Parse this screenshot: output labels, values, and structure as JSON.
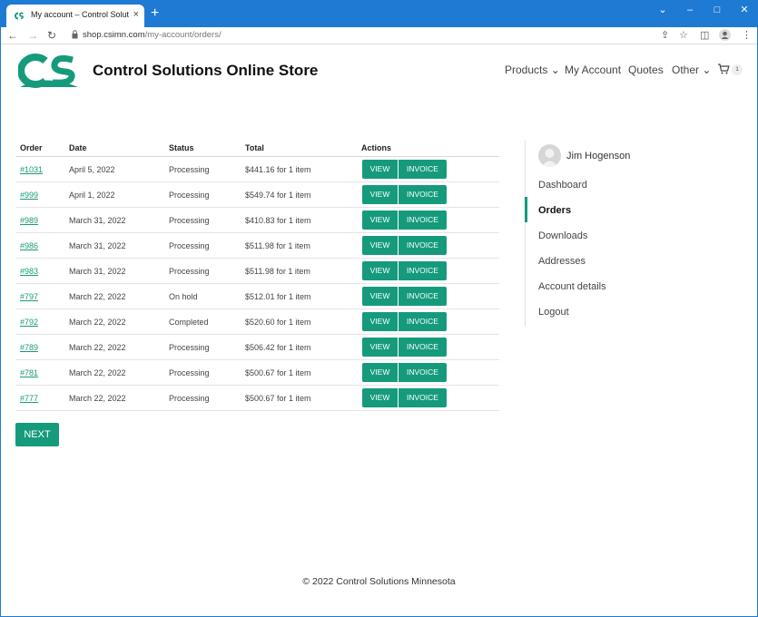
{
  "browser": {
    "tab_title": "My account – Control Solutions Online Store",
    "tab_close": "×",
    "new_tab": "+",
    "url_host": "shop.csimn.com",
    "url_path": "/my-account/orders/",
    "controls": {
      "min": "⌄",
      "minimize": "–",
      "maximize": "□",
      "close": "✕"
    },
    "nav": {
      "back": "←",
      "forward": "→",
      "reload": "↻"
    },
    "toolbar_icons": {
      "share": "⇪",
      "star": "☆",
      "sidebar": "◫",
      "menu": "⋮"
    }
  },
  "site": {
    "title": "Control Solutions Online Store",
    "brand_color": "#159b7c",
    "logo_letters": "CS"
  },
  "nav": {
    "products": "Products ⌄",
    "my_account": "My Account",
    "quotes": "Quotes",
    "other": "Other ⌄",
    "cart_count": "1"
  },
  "table": {
    "headers": {
      "order": "Order",
      "date": "Date",
      "status": "Status",
      "total": "Total",
      "actions": "Actions"
    },
    "view_label": "VIEW",
    "invoice_label": "INVOICE",
    "rows": [
      {
        "order": "#1031",
        "date": "April 5, 2022",
        "status": "Processing",
        "total": "$441.16 for 1 item"
      },
      {
        "order": "#999",
        "date": "April 1, 2022",
        "status": "Processing",
        "total": "$549.74 for 1 item"
      },
      {
        "order": "#989",
        "date": "March 31, 2022",
        "status": "Processing",
        "total": "$410.83 for 1 item"
      },
      {
        "order": "#986",
        "date": "March 31, 2022",
        "status": "Processing",
        "total": "$511.98 for 1 item"
      },
      {
        "order": "#983",
        "date": "March 31, 2022",
        "status": "Processing",
        "total": "$511.98 for 1 item"
      },
      {
        "order": "#797",
        "date": "March 22, 2022",
        "status": "On hold",
        "total": "$512.01 for 1 item"
      },
      {
        "order": "#792",
        "date": "March 22, 2022",
        "status": "Completed",
        "total": "$520.60 for 1 item"
      },
      {
        "order": "#789",
        "date": "March 22, 2022",
        "status": "Processing",
        "total": "$506.42 for 1 item"
      },
      {
        "order": "#781",
        "date": "March 22, 2022",
        "status": "Processing",
        "total": "$500.67 for 1 item"
      },
      {
        "order": "#777",
        "date": "March 22, 2022",
        "status": "Processing",
        "total": "$500.67 for 1 item"
      }
    ],
    "next_label": "NEXT"
  },
  "sidebar": {
    "username": "Jim Hogenson",
    "items": [
      "Dashboard",
      "Orders",
      "Downloads",
      "Addresses",
      "Account details",
      "Logout"
    ],
    "active": "Orders"
  },
  "footer": {
    "text": "© 2022 Control Solutions Minnesota"
  }
}
